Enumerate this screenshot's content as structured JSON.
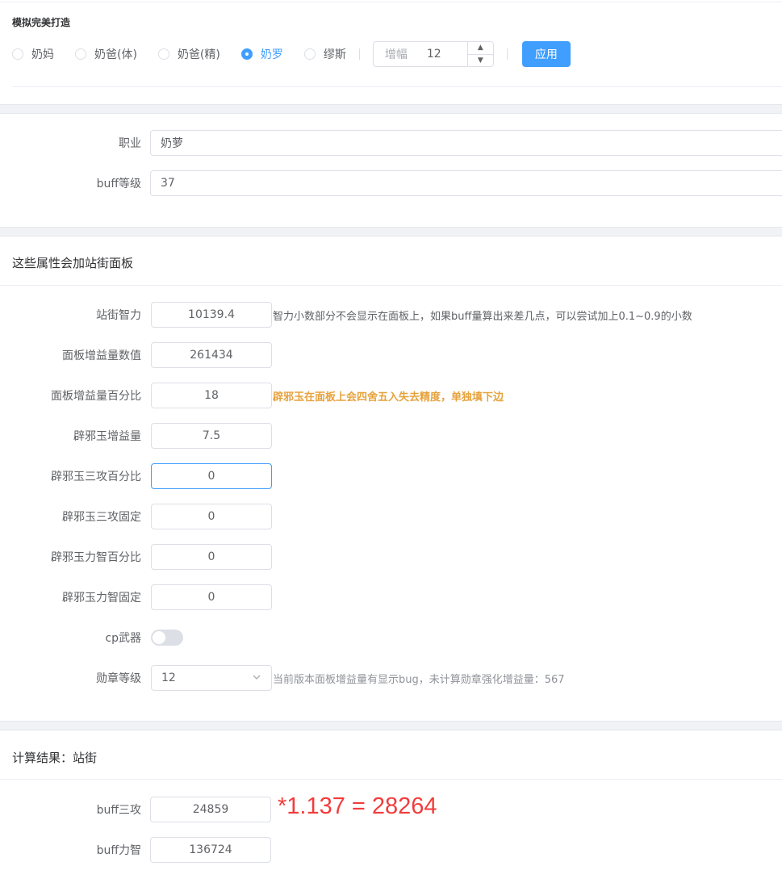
{
  "simulate": {
    "title": "模拟完美打造",
    "options": [
      {
        "label": "奶妈",
        "checked": false
      },
      {
        "label": "奶爸(体)",
        "checked": false
      },
      {
        "label": "奶爸(精)",
        "checked": false
      },
      {
        "label": "奶罗",
        "checked": true
      },
      {
        "label": "缪斯",
        "checked": false
      }
    ],
    "amp_prefix": "增幅",
    "amp_value": "12",
    "apply_label": "应用"
  },
  "basic": {
    "job_label": "职业",
    "job_value": "奶萝",
    "buff_level_label": "buff等级",
    "buff_level_value": "37"
  },
  "stats": {
    "title": "这些属性会加站街面板",
    "fields": [
      {
        "label": "站街智力",
        "value": "10139.4"
      },
      {
        "label": "面板增益量数值",
        "value": "261434"
      },
      {
        "label": "面板增益量百分比",
        "value": "18"
      },
      {
        "label": "辟邪玉增益量",
        "value": "7.5"
      },
      {
        "label": "辟邪玉三攻百分比",
        "value": "0"
      },
      {
        "label": "辟邪玉三攻固定",
        "value": "0"
      },
      {
        "label": "辟邪玉力智百分比",
        "value": "0"
      },
      {
        "label": "辟邪玉力智固定",
        "value": "0"
      }
    ],
    "hint_int": "智力小数部分不会显示在面板上，如果buff量算出来差几点，可以尝试加上0.1~0.9的小数",
    "hint_percent": "辟邪玉在面板上会四舍五入失去精度，单独填下边",
    "cp_label": "cp武器",
    "medal_label": "勋章等级",
    "medal_value": "12",
    "hint_medal": "当前版本面板增益量有显示bug，未计算勋章强化增益量：567"
  },
  "result": {
    "title": "计算结果：站街",
    "atk_label": "buff三攻",
    "atk_value": "24859",
    "atk_note": "*1.137 = 28264",
    "stat_label": "buff力智",
    "stat_value": "136724"
  }
}
